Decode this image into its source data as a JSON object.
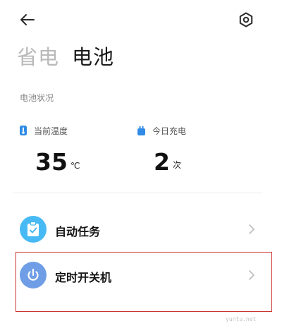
{
  "header": {
    "back_icon": "arrow-left-icon",
    "settings_icon": "hexagon-settings-icon"
  },
  "tabs": [
    {
      "label": "省电",
      "active": false
    },
    {
      "label": "电池",
      "active": true
    }
  ],
  "battery_status": {
    "title": "电池状况",
    "stats": [
      {
        "label": "当前温度",
        "value": "35",
        "unit": "℃",
        "icon": "thermometer-icon",
        "color": "#2f8be6"
      },
      {
        "label": "今日充电",
        "value": "2",
        "unit": "次",
        "icon": "charging-icon",
        "color": "#2f8be6"
      }
    ]
  },
  "list": [
    {
      "label": "自动任务",
      "icon": "clipboard-check-icon",
      "icon_bg": "#47b9f5"
    },
    {
      "label": "定时开关机",
      "icon": "power-icon",
      "icon_bg": "#6f9ee6"
    }
  ],
  "watermark": "yuntu.net"
}
